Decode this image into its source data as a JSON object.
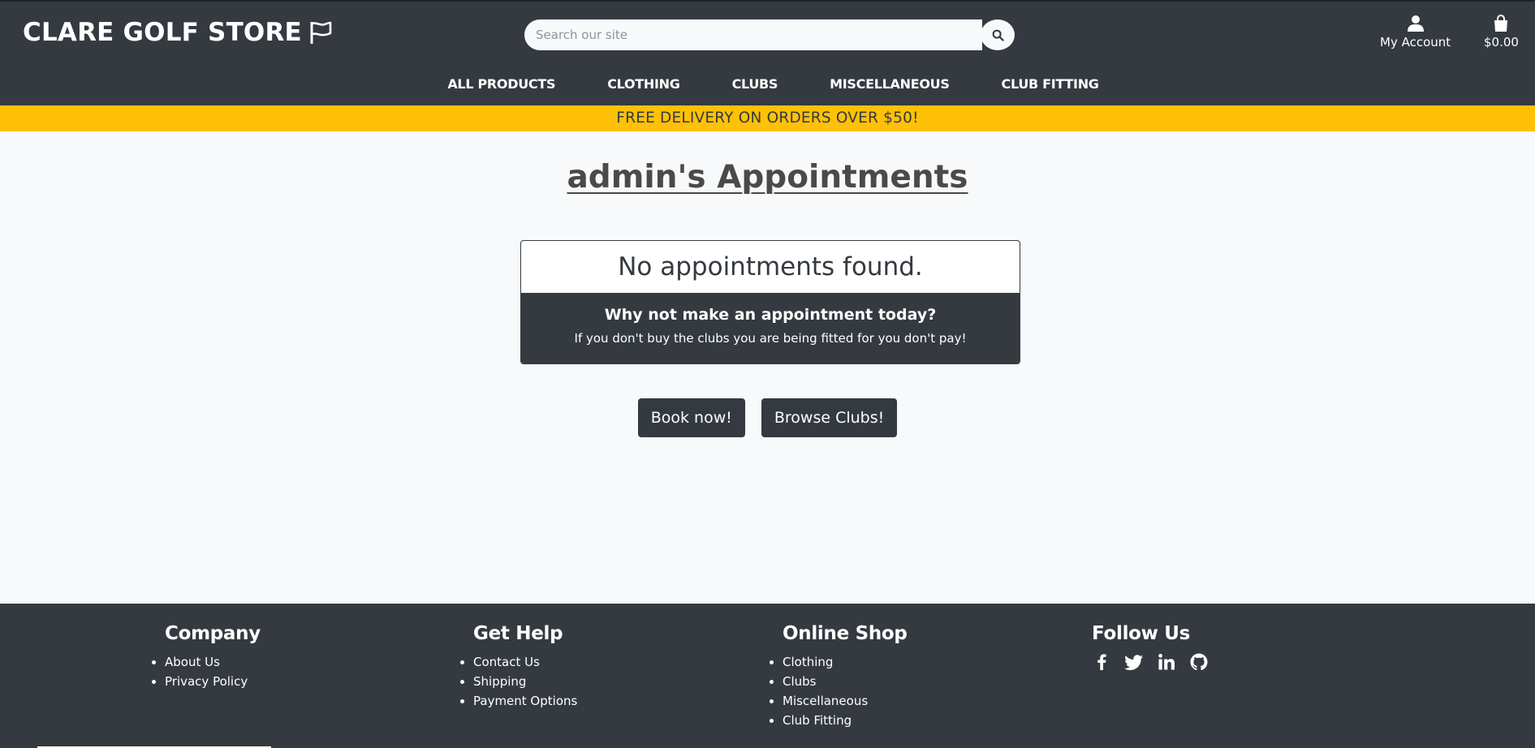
{
  "brand": {
    "name": "CLARE GOLF STORE"
  },
  "search": {
    "placeholder": "Search our site"
  },
  "account": {
    "label": "My Account"
  },
  "bag": {
    "total": "$0.00"
  },
  "nav": [
    {
      "label": "ALL PRODUCTS"
    },
    {
      "label": "CLOTHING"
    },
    {
      "label": "CLUBS"
    },
    {
      "label": "MISCELLANEOUS"
    },
    {
      "label": "CLUB FITTING"
    }
  ],
  "promo": {
    "text": "FREE DELIVERY ON ORDERS OVER $50!"
  },
  "page": {
    "title": "admin's Appointments"
  },
  "card": {
    "heading": "No appointments found.",
    "subheading": "Why not make an appointment today?",
    "text": "If you don't buy the clubs you are being fitted for you don't pay!"
  },
  "buttons": {
    "book": "Book now!",
    "browse": "Browse Clubs!"
  },
  "footer": {
    "company": {
      "title": "Company",
      "links": [
        "About Us",
        "Privacy Policy"
      ]
    },
    "help": {
      "title": "Get Help",
      "links": [
        "Contact Us",
        "Shipping",
        "Payment Options"
      ]
    },
    "shop": {
      "title": "Online Shop",
      "links": [
        "Clothing",
        "Clubs",
        "Miscellaneous",
        "Club Fitting"
      ]
    },
    "follow": {
      "title": "Follow Us",
      "icons": [
        "facebook-icon",
        "twitter-icon",
        "linkedin-icon",
        "github-icon"
      ]
    }
  },
  "colors": {
    "dark": "#343a40",
    "accent": "#ffc107",
    "light": "#f8f9fa"
  }
}
